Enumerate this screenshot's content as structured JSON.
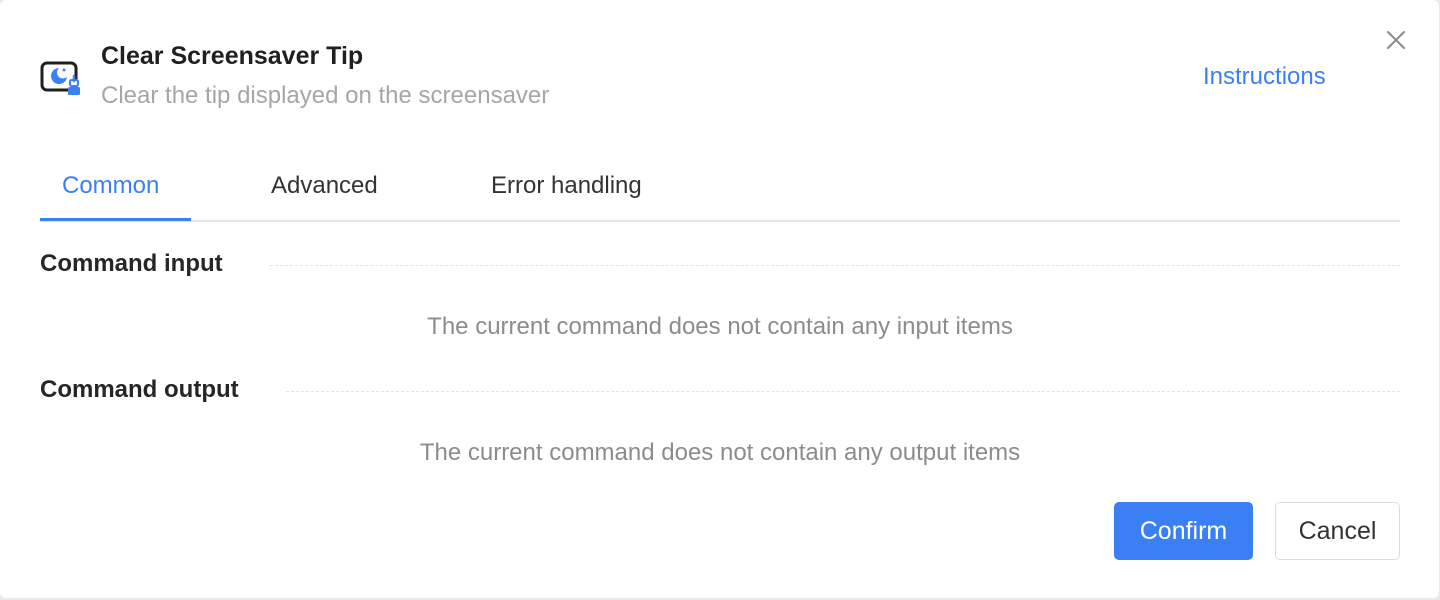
{
  "dialog": {
    "title": "Clear Screensaver Tip",
    "subtitle": "Clear the tip displayed on the screensaver",
    "instructions_link": "Instructions",
    "icon": "screensaver-clear-icon",
    "close_icon": "close-icon"
  },
  "tabs": [
    {
      "label": "Common",
      "active": true
    },
    {
      "label": "Advanced",
      "active": false
    },
    {
      "label": "Error handling",
      "active": false
    }
  ],
  "sections": {
    "input": {
      "title": "Command input",
      "empty_text": "The current command does not contain any input items"
    },
    "output": {
      "title": "Command output",
      "empty_text": "The current command does not contain any output items"
    }
  },
  "footer": {
    "confirm_label": "Confirm",
    "cancel_label": "Cancel"
  },
  "colors": {
    "accent": "#3b7ff5",
    "title_text": "#1f1f1f",
    "muted_text": "#a6a6a6",
    "empty_text": "#8c8c8c"
  }
}
